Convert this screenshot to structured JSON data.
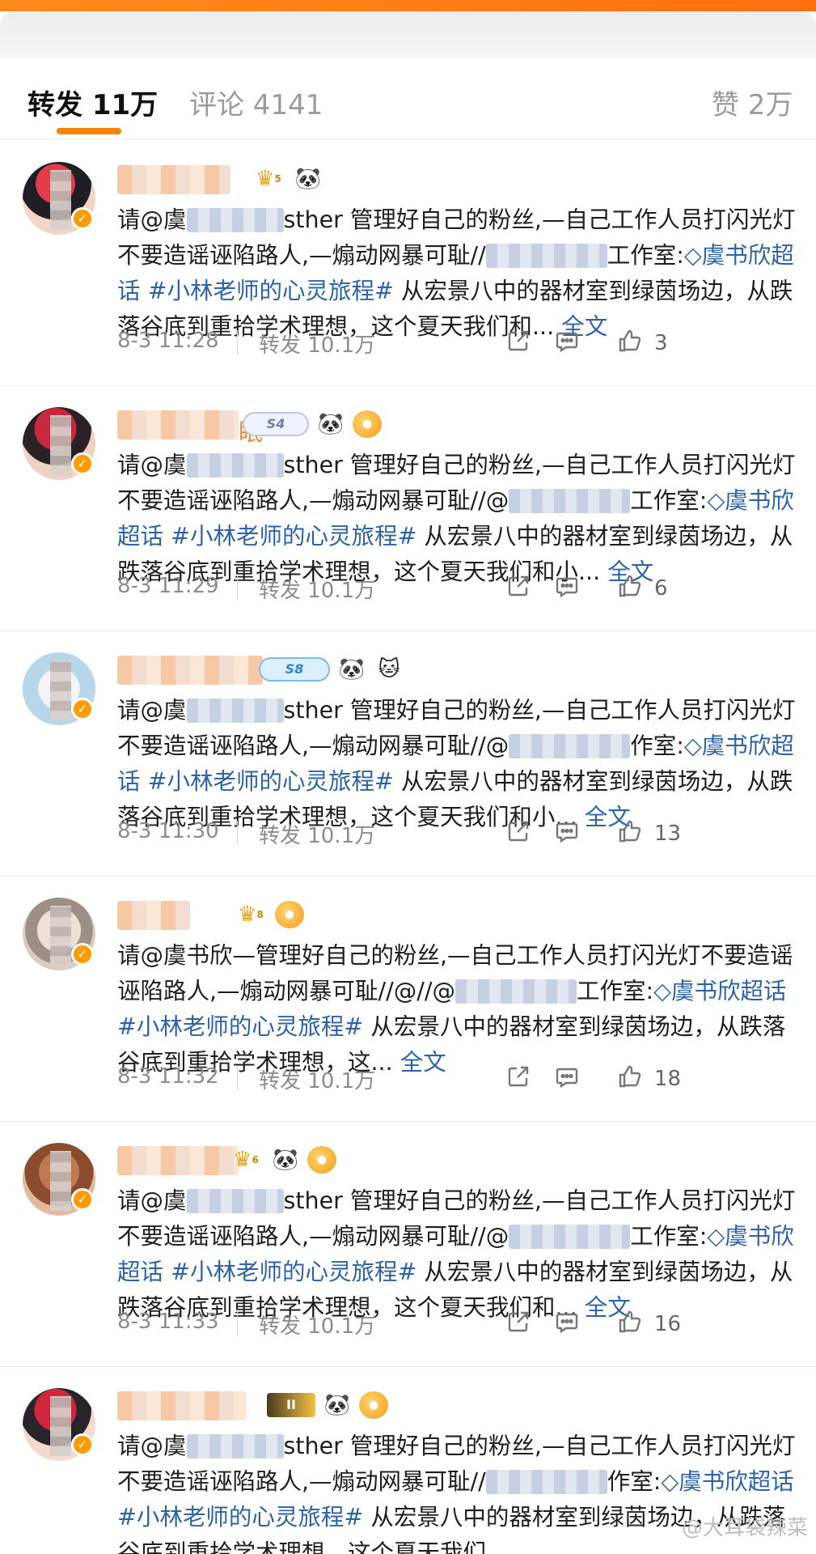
{
  "tabs": {
    "repost": "转发 11万",
    "comment": "评论 4141",
    "like": "赞 2万"
  },
  "link_topic": "#小林老师的心灵旅程#",
  "actions": {
    "share_icon": "share-icon",
    "comment_icon": "comment-icon",
    "like_icon": "thumbs-up-icon"
  },
  "posts": [
    {
      "name_visible": "",
      "body_pre": "请@虞",
      "body_mid": "sther 管理好自己的粉丝,—自己工作人员打闪光灯不要造谣诬陷路人,—煽动网暴可耻//",
      "link_blur_tail": "工作室:",
      "supertopic": "◇虞书欣超话",
      "topic": "#小林老师的心灵旅程#",
      "tail": "从宏景八中的器材室到绿茵场边，从跌落谷底到重拾学术理想，这个夏天我们和...",
      "more": "全文",
      "time": "8-3 11:28",
      "repost": "转发 10.1万",
      "likes": "3"
    },
    {
      "name_visible": "眠",
      "body_pre": "请@虞",
      "body_mid": "sther 管理好自己的粉丝,—自己工作人员打闪光灯不要造谣诬陷路人,—煽动网暴可耻//@",
      "link_blur_tail": "工作室:",
      "supertopic": "◇虞书欣超话",
      "topic": "#小林老师的心灵旅程#",
      "tail": "从宏景八中的器材室到绿茵场边，从跌落谷底到重拾学术理想，这个夏天我们和小...",
      "more": "全文",
      "time": "8-3 11:29",
      "repost": "转发 10.1万",
      "likes": "6"
    },
    {
      "name_visible": "",
      "body_pre": "请@虞",
      "body_mid": "sther 管理好自己的粉丝,—自己工作人员打闪光灯不要造谣诬陷路人,—煽动网暴可耻//@",
      "link_blur_tail": "作室:",
      "supertopic": "◇虞书欣超话",
      "topic": "#小林老师的心灵旅程#",
      "tail": "从宏景八中的器材室到绿茵场边，从跌落谷底到重拾学术理想，这个夏天我们和小...",
      "more": "全文",
      "time": "8-3 11:30",
      "repost": "转发 10.1万",
      "likes": "13"
    },
    {
      "name_visible": "",
      "body_pre": "请@虞书欣—管理好自己的粉丝,—自己工作人员打闪光灯不要造谣诬陷路人,—煽动网暴可耻//@//@",
      "body_mid": "",
      "link_blur_tail": "工作室:",
      "supertopic": "◇虞书欣超话",
      "topic": "#小林老师的心灵旅程#",
      "tail": "从宏景八中的器材室到绿茵场边，从跌落谷底到重拾学术理想，这...",
      "more": "全文",
      "time": "8-3 11:32",
      "repost": "转发 10.1万",
      "likes": "18"
    },
    {
      "name_visible": "",
      "body_pre": "请@虞",
      "body_mid": "sther 管理好自己的粉丝,—自己工作人员打闪光灯不要造谣诬陷路人,—煽动网暴可耻//@",
      "link_blur_tail": "工作室:",
      "supertopic": "◇虞书欣超话",
      "topic": "#小林老师的心灵旅程#",
      "tail": "从宏景八中的器材室到绿茵场边，从跌落谷底到重拾学术理想，这个夏天我们和...",
      "more": "全文",
      "time": "8-3 11:33",
      "repost": "转发 10.1万",
      "likes": "16"
    },
    {
      "name_visible": "",
      "body_pre": "请@虞",
      "body_mid": "sther 管理好自己的粉丝,—自己工作人员打闪光灯不要造谣诬陷路人,—煽动网暴可耻//",
      "link_blur_tail": "作室:",
      "supertopic": "◇虞书欣超话",
      "topic": "#小林老师的心灵旅程#",
      "tail": "从宏景八中的器材室到绿茵场边，从跌落谷底到重拾学术理想，这个夏天我们",
      "more": "",
      "time": "",
      "repost": "",
      "likes": ""
    }
  ],
  "watermark": "@大耳袋辣菜",
  "colors": {
    "accent": "#ff8200",
    "link": "#2d63a8",
    "verified": "#ff9a00"
  }
}
